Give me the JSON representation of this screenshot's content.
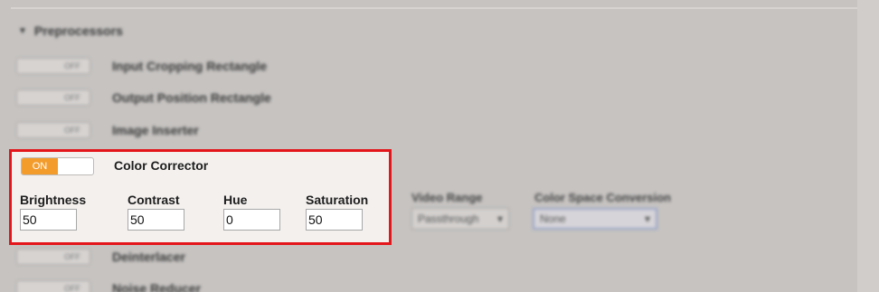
{
  "section": {
    "title": "Preprocessors"
  },
  "rows_top": [
    {
      "label": "Input Cropping Rectangle",
      "state": "OFF"
    },
    {
      "label": "Output Position Rectangle",
      "state": "OFF"
    },
    {
      "label": "Image Inserter",
      "state": "OFF"
    }
  ],
  "color_corrector": {
    "toggle_state": "ON",
    "title": "Color Corrector",
    "fields": [
      {
        "label": "Brightness",
        "value": "50"
      },
      {
        "label": "Contrast",
        "value": "50"
      },
      {
        "label": "Hue",
        "value": "0"
      },
      {
        "label": "Saturation",
        "value": "50"
      }
    ]
  },
  "video_range": {
    "label": "Video Range",
    "value": "Passthrough"
  },
  "color_space": {
    "label": "Color Space Conversion",
    "value": "None"
  },
  "rows_bottom": [
    {
      "label": "Deinterlacer",
      "state": "OFF"
    },
    {
      "label": "Noise Reducer",
      "state": "OFF"
    }
  ],
  "colors": {
    "highlight_border": "#e4151b",
    "toggle_on": "#f39c2c"
  }
}
